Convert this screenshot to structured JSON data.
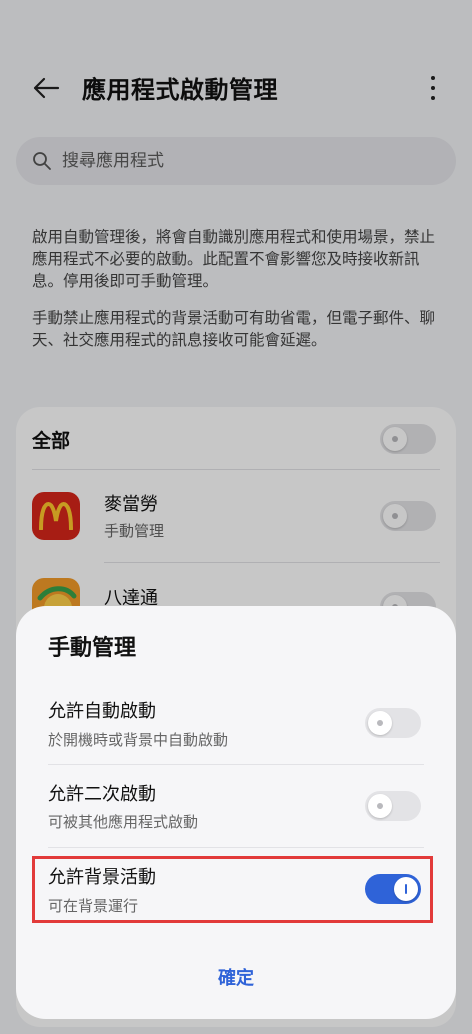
{
  "header": {
    "title": "應用程式啟動管理"
  },
  "search": {
    "placeholder": "搜尋應用程式"
  },
  "description": {
    "paragraph1": "啟用自動管理後，將會自動識別應用程式和使用場景，禁止應用程式不必要的啟動。此配置不會影響您及時接收新訊息。停用後即可手動管理。",
    "paragraph2": "手動禁止應用程式的背景活動可有助省電，但電子郵件、聊天、社交應用程式的訊息接收可能會延遲。"
  },
  "list": {
    "all_label": "全部",
    "all_switch_on": false,
    "apps": [
      {
        "name": "麥當勞",
        "status": "手動管理",
        "icon": "mcdonalds-icon",
        "switch_on": false
      },
      {
        "name": "八達通",
        "status": "",
        "icon": "octopus-icon",
        "switch_on": false
      }
    ]
  },
  "sheet": {
    "title": "手動管理",
    "options": [
      {
        "label": "允許自動啟動",
        "sub": "於開機時或背景中自動啟動",
        "on": false
      },
      {
        "label": "允許二次啟動",
        "sub": "可被其他應用程式啟動",
        "on": false
      },
      {
        "label": "允許背景活動",
        "sub": "可在背景運行",
        "on": true
      }
    ],
    "confirm_label": "確定"
  },
  "colors": {
    "accent": "#2f63d8",
    "highlight": "#e23a3a",
    "mcdonalds_red": "#d6261a",
    "mcdonalds_yellow": "#ffc72c"
  }
}
